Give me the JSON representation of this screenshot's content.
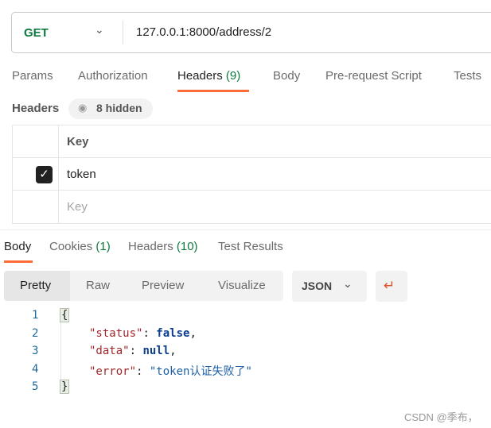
{
  "request": {
    "method": "GET",
    "url": "127.0.0.1:8000/address/2"
  },
  "request_tabs": [
    {
      "label": "Params"
    },
    {
      "label": "Authorization"
    },
    {
      "label": "Headers",
      "count": "(9)"
    },
    {
      "label": "Body"
    },
    {
      "label": "Pre-request Script"
    },
    {
      "label": "Tests"
    }
  ],
  "headers_section": {
    "title": "Headers",
    "hidden_label": "8 hidden",
    "key_header": "Key",
    "rows": [
      {
        "key": "token",
        "checked": true
      }
    ],
    "key_placeholder": "Key"
  },
  "response_tabs": [
    {
      "label": "Body"
    },
    {
      "label": "Cookies",
      "count": "(1)"
    },
    {
      "label": "Headers",
      "count": "(10)"
    },
    {
      "label": "Test Results"
    }
  ],
  "view_modes": [
    "Pretty",
    "Raw",
    "Preview",
    "Visualize"
  ],
  "format": "JSON",
  "code_lines": [
    "1",
    "2",
    "3",
    "4",
    "5"
  ],
  "json": {
    "open": "{",
    "close": "}",
    "k1": "\"status\"",
    "v1": "false",
    "k2": "\"data\"",
    "v2": "null",
    "k3": "\"error\"",
    "v3": "\"token认证失败了\""
  },
  "watermark": "CSDN @季布，",
  "colors": {
    "accent": "#ff6c37",
    "method": "#0b7a3e"
  }
}
